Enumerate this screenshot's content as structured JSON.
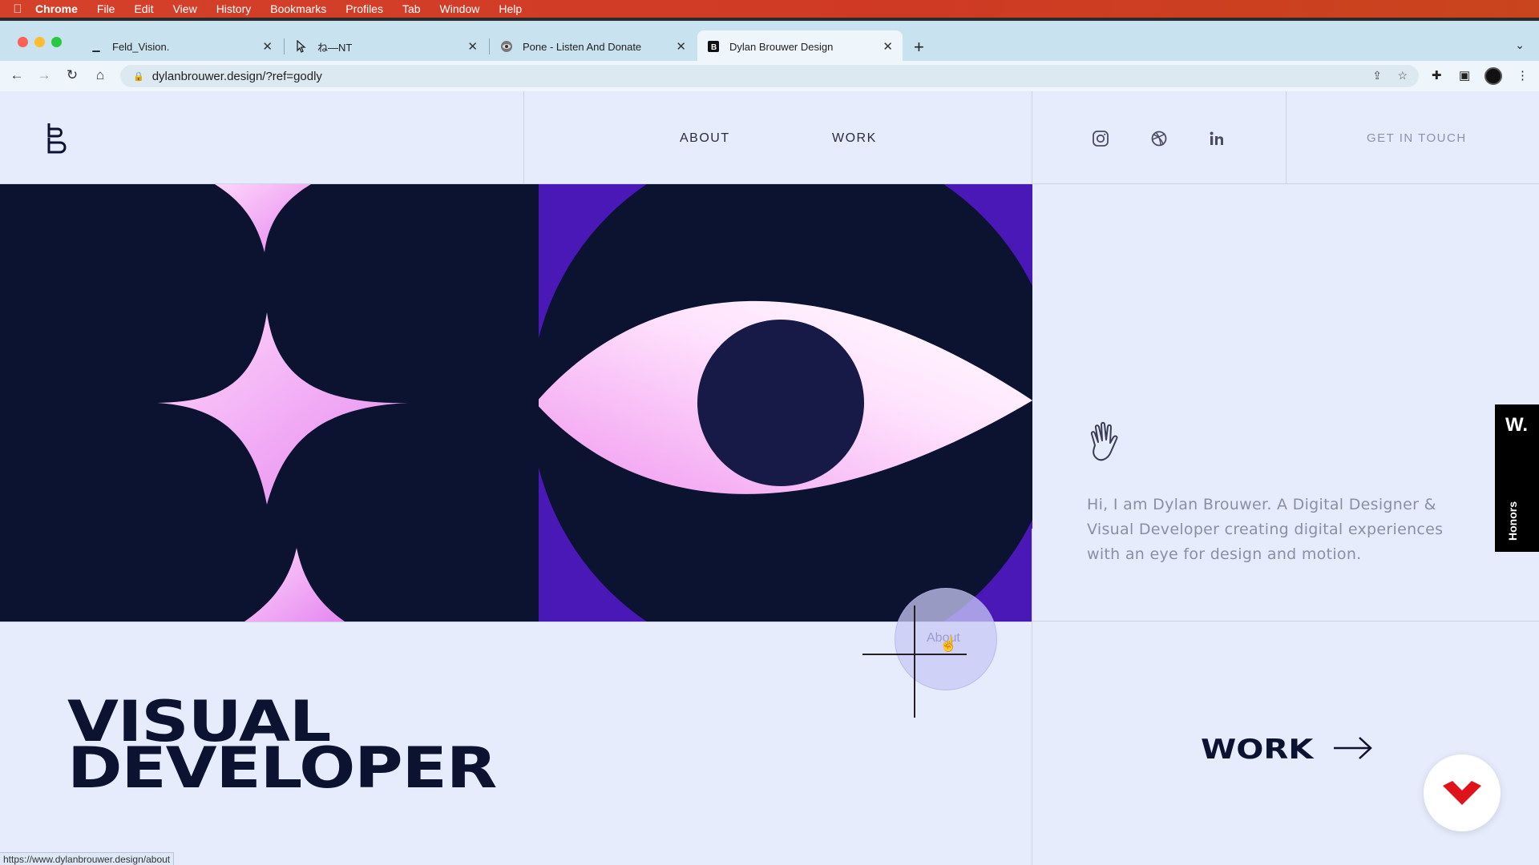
{
  "menubar": {
    "items": [
      "Chrome",
      "File",
      "Edit",
      "View",
      "History",
      "Bookmarks",
      "Profiles",
      "Tab",
      "Window",
      "Help"
    ]
  },
  "tabs": [
    {
      "title": "Feld_Vision.",
      "active": false
    },
    {
      "title": "ね—NT",
      "active": false
    },
    {
      "title": "Pone - Listen And Donate",
      "active": false
    },
    {
      "title": "Dylan Brouwer Design",
      "active": true
    }
  ],
  "address": {
    "url": "dylanbrouwer.design/?ref=godly"
  },
  "site": {
    "nav": {
      "about": "ABOUT",
      "work": "WORK",
      "cta": "GET IN TOUCH"
    },
    "intro": "Hi, I am Dylan Brouwer. A Digital Designer & Visual Developer creating digital experiences with an eye for design and motion.",
    "headline": {
      "line1": "VISUAL",
      "line2": "DEVELOPER"
    },
    "work_link": "WORK",
    "cursor_label": "About",
    "honors": {
      "logo": "W.",
      "label": "Honors"
    }
  },
  "status_url": "https://www.dylanbrouwer.design/about",
  "colors": {
    "navy": "#0c1330",
    "purple": "#4b18b8",
    "pink": "#f7b6f2",
    "background": "#e6ecfb",
    "menubar": "#d4402a"
  },
  "icons": [
    "apple-icon",
    "instagram-icon",
    "dribbble-icon",
    "linkedin-icon",
    "wave-hand-icon",
    "arrow-right-icon"
  ]
}
